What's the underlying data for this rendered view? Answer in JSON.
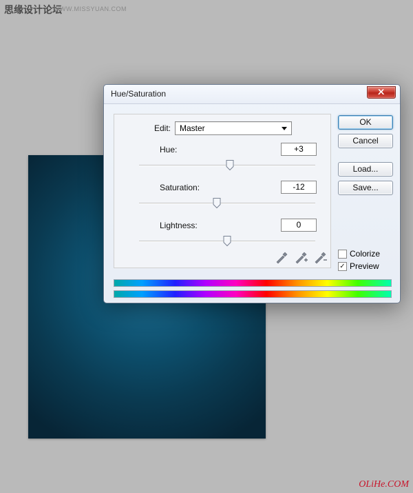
{
  "page": {
    "top_caption": "思缘设计论坛",
    "top_url": "WWW.MISSYUAN.COM",
    "bottom_brand": "OLiHe.COM"
  },
  "dialog": {
    "title": "Hue/Saturation",
    "edit_label": "Edit:",
    "edit_value": "Master",
    "hue": {
      "label": "Hue:",
      "value": "+3",
      "pos": 51.5
    },
    "saturation": {
      "label": "Saturation:",
      "value": "-12",
      "pos": 44
    },
    "lightness": {
      "label": "Lightness:",
      "value": "0",
      "pos": 50
    },
    "buttons": {
      "ok": "OK",
      "cancel": "Cancel",
      "load": "Load...",
      "save": "Save..."
    },
    "colorize": {
      "label": "Colorize",
      "checked": false
    },
    "preview": {
      "label": "Preview",
      "checked": true
    },
    "close_glyph": "X"
  }
}
